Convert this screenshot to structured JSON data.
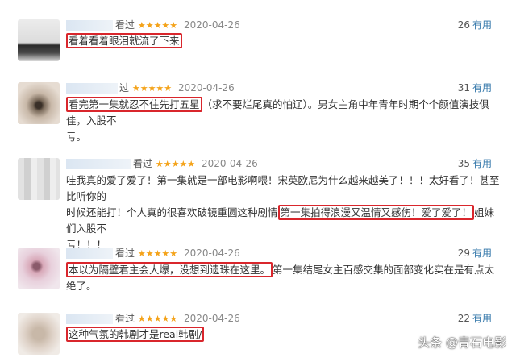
{
  "reviews": [
    {
      "seen": "看过",
      "stars": "★★★★★",
      "date": "2020-04-26",
      "count": "26",
      "useful": "有用",
      "highlight": "看着看着眼泪就流了下来",
      "line1_rest": "",
      "line2": "",
      "line3": ""
    },
    {
      "seen": "过",
      "stars": "★★★★★",
      "date": "2020-04-26",
      "count": "31",
      "useful": "有用",
      "highlight": "看完第一集就忍不住先打五星",
      "line1_rest": "（求不要烂尾真的怕辽）。男女主角中年青年时期个个颜值演技俱佳，入股不",
      "line2": "亏。",
      "line3": ""
    },
    {
      "seen": "看过",
      "stars": "★★★★★",
      "date": "2020-04-26",
      "count": "35",
      "useful": "有用",
      "line1": "哇我真的爱了爱了！第一集就是一部电影啊喂！宋英欧尼为什么越来越美了！！！太好看了！甚至比听你的",
      "line2_pre": "时候还能打！个人真的很喜欢破镜重圆这种剧情",
      "highlight": "第一集拍得浪漫又温情又感伤！爱了爱了！",
      "line2_post": "姐妹们入股不",
      "line3": "亏！！！"
    },
    {
      "seen": "看过",
      "stars": "★★★★★",
      "date": "2020-04-26",
      "count": "29",
      "useful": "有用",
      "highlight": "本以为隔壁君主会大爆，没想到遗珠在这里。",
      "line1_rest": "第一集结尾女主百感交集的面部变化实在是有点太绝了。",
      "line2": "",
      "line3": ""
    },
    {
      "seen": "看过",
      "stars": "★★★★★",
      "date": "2020-04-26",
      "count": "22",
      "useful": "有用",
      "highlight": "这种气氛的韩剧才是real韩剧/",
      "line1_rest": "",
      "line2": "",
      "line3": ""
    }
  ],
  "watermark": "头条 @青石电影"
}
